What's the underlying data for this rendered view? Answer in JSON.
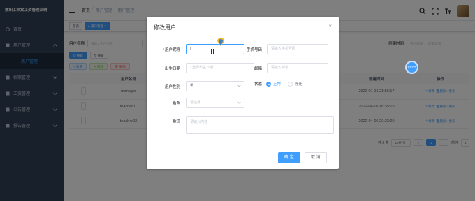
{
  "sidebar": {
    "brand": "教职工档案工资管理系统",
    "items": [
      {
        "label": "首页",
        "icon": "dashboard-icon"
      },
      {
        "label": "用户管理",
        "icon": "user-icon"
      },
      {
        "label": "用户管理",
        "icon": "",
        "sub": true
      },
      {
        "label": "档案管理",
        "icon": "folder-icon"
      },
      {
        "label": "工资管理",
        "icon": "money-icon"
      },
      {
        "label": "公告管理",
        "icon": "notice-icon"
      },
      {
        "label": "报告管理",
        "icon": "report-icon"
      }
    ]
  },
  "navbar": {
    "breadcrumb": [
      "首页",
      "/",
      "用户管理",
      "/",
      "用户管理"
    ]
  },
  "tags": [
    "首页",
    "● 用户管理 ×"
  ],
  "search": {
    "username_label": "用户名称",
    "username_placeholder": "请输入用户名称",
    "created_label": "创建时间",
    "start_placeholder": "开始日期",
    "end_placeholder": "结束日期",
    "search_btn": "Q 搜索",
    "reset_btn": "↻ 重置"
  },
  "toolbar": {
    "add": "+ 新增",
    "edit": "✎ 修改",
    "delete": "🗑 删除"
  },
  "table": {
    "headers": [
      "",
      "用户名称",
      "状态",
      "创建时间",
      "操作"
    ],
    "rows": [
      {
        "name": "manager",
        "created": "2022-01-16 21:56:17"
      },
      {
        "name": "teacher01",
        "created": "2022-04-06 16:35:15"
      },
      {
        "name": "teacher02",
        "created": "2022-04-06 20:32:20"
      }
    ],
    "ops": [
      "✎修改",
      "🗑删除",
      "»更多"
    ]
  },
  "pagination": {
    "total": "共 3 条",
    "size": "10条/页",
    "page": "1",
    "goto": "前往",
    "goto_page": "1"
  },
  "badge": "01:07",
  "dialog": {
    "title": "修改用户",
    "nickname_label": "用户昵称",
    "nickname_value": "l",
    "phone_label": "手机号码",
    "phone_placeholder": "请输入手机号码",
    "birth_label": "出生日期",
    "birth_placeholder": "选择出生日期",
    "email_label": "邮箱",
    "email_placeholder": "请输入邮箱",
    "gender_label": "用户性别",
    "gender_value": "男",
    "status_label": "状态",
    "status_on": "正常",
    "status_off": "停用",
    "role_label": "角色",
    "role_placeholder": "请选择",
    "remark_label": "备注",
    "remark_placeholder": "请输入内容",
    "confirm": "确 定",
    "cancel": "取 消"
  },
  "colors": {
    "primary": "#409eff",
    "sidebar": "#304156"
  }
}
